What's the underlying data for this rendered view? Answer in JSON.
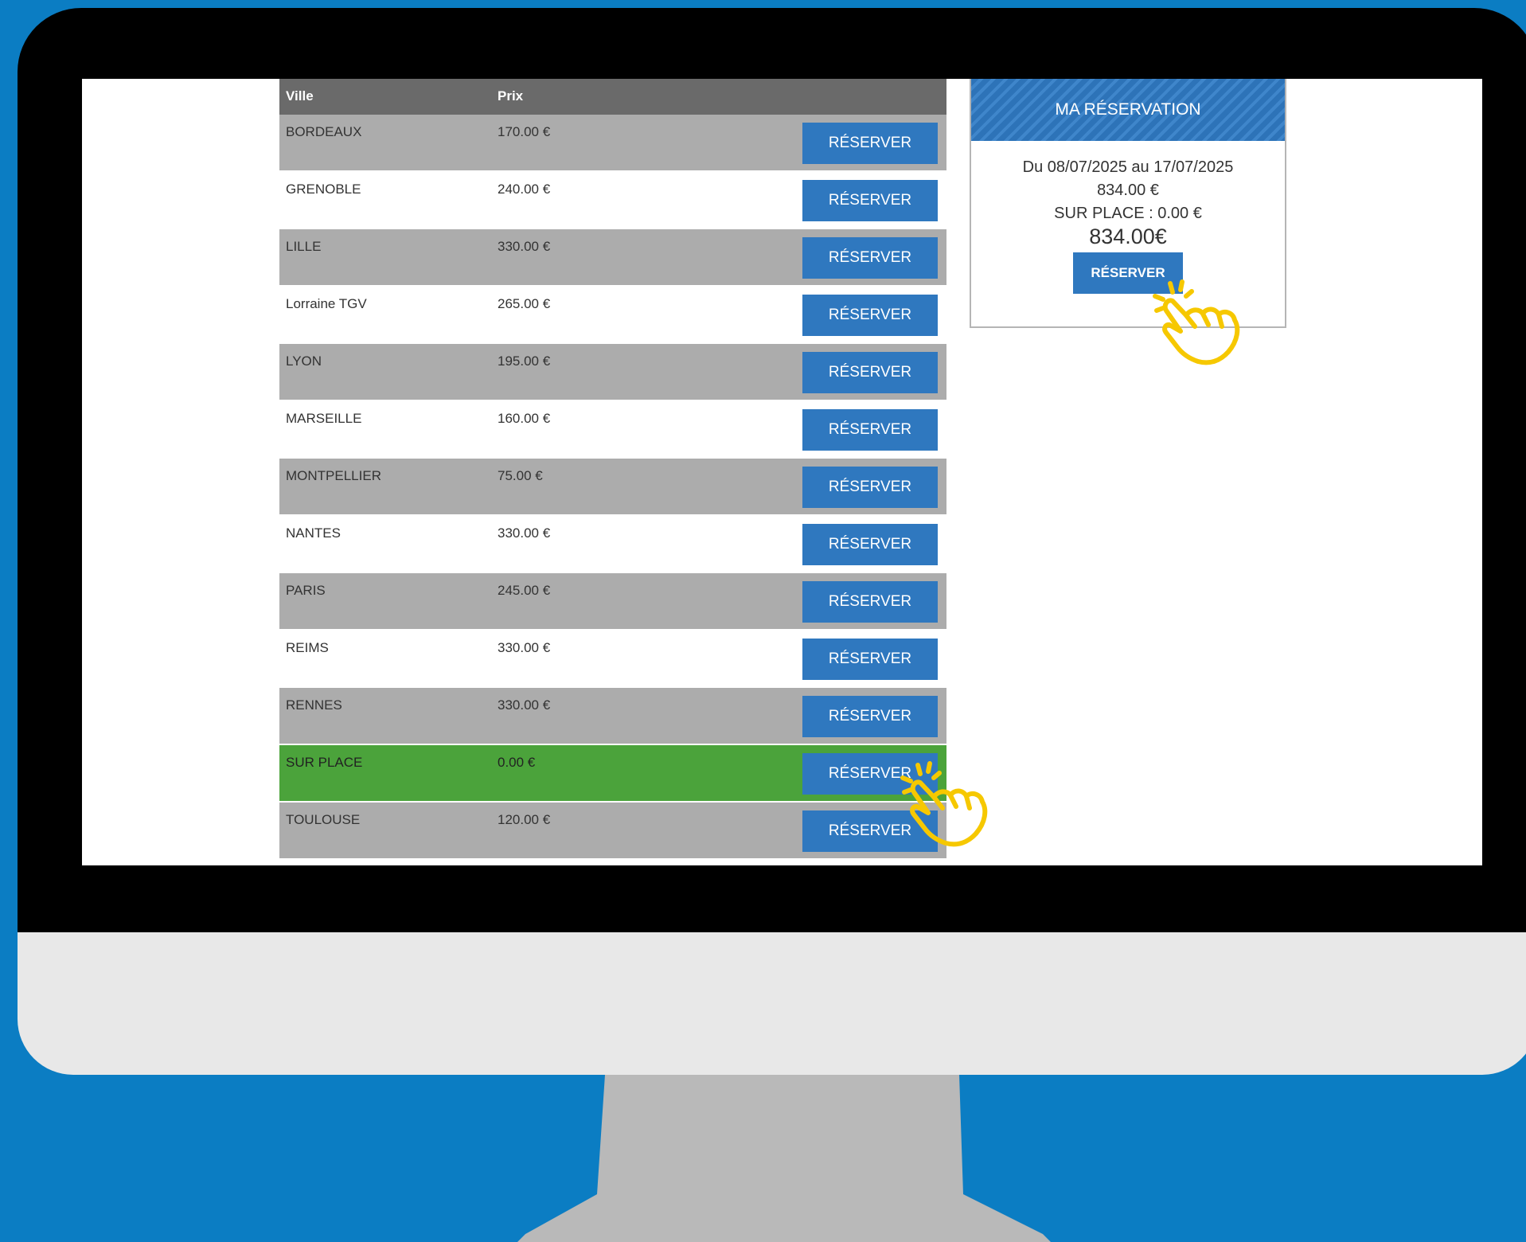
{
  "table": {
    "header_city": "Ville",
    "header_price": "Prix",
    "rows": [
      {
        "city": "BORDEAUX",
        "price": "170.00 €",
        "button": "RÉSERVER"
      },
      {
        "city": "GRENOBLE",
        "price": "240.00 €",
        "button": "RÉSERVER"
      },
      {
        "city": "LILLE",
        "price": "330.00 €",
        "button": "RÉSERVER"
      },
      {
        "city": "Lorraine TGV",
        "price": "265.00 €",
        "button": "RÉSERVER"
      },
      {
        "city": "LYON",
        "price": "195.00 €",
        "button": "RÉSERVER"
      },
      {
        "city": "MARSEILLE",
        "price": "160.00 €",
        "button": "RÉSERVER"
      },
      {
        "city": "MONTPELLIER",
        "price": "75.00 €",
        "button": "RÉSERVER"
      },
      {
        "city": "NANTES",
        "price": "330.00 €",
        "button": "RÉSERVER"
      },
      {
        "city": "PARIS",
        "price": "245.00 €",
        "button": "RÉSERVER"
      },
      {
        "city": "REIMS",
        "price": "330.00 €",
        "button": "RÉSERVER"
      },
      {
        "city": "RENNES",
        "price": "330.00 €",
        "button": "RÉSERVER"
      },
      {
        "city": "SUR PLACE",
        "price": "0.00 €",
        "button": "RÉSERVER"
      },
      {
        "city": "TOULOUSE",
        "price": "120.00 €",
        "button": "RÉSERVER"
      }
    ]
  },
  "reservation": {
    "title": "MA RÉSERVATION",
    "dates": "Du 08/07/2025 au 17/07/2025",
    "amount": "834.00 €",
    "sur_place": "SUR PLACE : 0.00 €",
    "total": "834.00€",
    "button": "RÉSERVER"
  },
  "colors": {
    "background": "#0b7dc3",
    "button": "#2f78bf",
    "highlight_row": "#4ba33b",
    "cursor": "#f6c800"
  },
  "icons": {
    "cursor": "hand-pointer-icon"
  }
}
